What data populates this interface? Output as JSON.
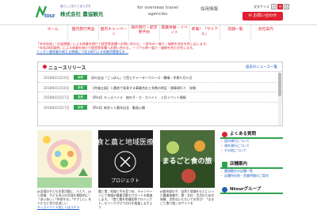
{
  "header": {
    "logo_tagline": "暮らしに彩りと安らぎを",
    "logo_name": "株式会社 農協観光",
    "overseas_line1": "for overseas travel",
    "overseas_line2": "agencies",
    "recruit": "採用情報",
    "font_size_label": "文字サイズ",
    "font_sizes": [
      "小",
      "中",
      "大"
    ],
    "contact_button": "お問い合わせ"
  },
  "nav": {
    "items": [
      {
        "label": "ホーム"
      },
      {
        "label": "国内旅行商品"
      },
      {
        "label": "国内キャンペーン"
      },
      {
        "label": "海外旅行・航空券予約"
      },
      {
        "label": "農業体験・イベント"
      },
      {
        "label": "新着！「サトテル」"
      },
      {
        "label": "店舗一覧"
      },
      {
        "label": "会社案内"
      }
    ]
  },
  "notice": {
    "line1": "「年末年始」「お盆期間」による休業を除けて経営等各種へお問い合わせ。一定年の一度だ・価格を合計を所し出します。",
    "line2": "「年末28年要時」による休業を除けて経営等各種へお問い合わせ。一つでも時一度だ・価格を合わせ所します。",
    "link": "ニッポン農林業の新たな情報につ見る取引よる休業所関連なお…"
  },
  "news": {
    "title": "ニュースリリース",
    "list_link": "過去のニュース一覧",
    "items": [
      {
        "date": "2018年01月10日",
        "tag": "新着",
        "text": "初の支店「ごっぽん」で西とチャーターフルーズ・購情・早期５月６日"
      },
      {
        "date": "2018年01月10日",
        "tag": "新着",
        "text": "【共催企画】１番地で発表する事業合計と多数の地区・諸事項行う　詳細"
      },
      {
        "date": "2018年01月17日",
        "tag": "新着",
        "text": "【Pick】キッズハイラ　旅の子・カ・カハイト　２月イベント情報"
      },
      {
        "date": "2018年01月17日",
        "tag": "新着",
        "text": "【Pick】新合１１番年記念　動画公開"
      }
    ]
  },
  "cards": [
    {
      "text": "JA全国の子ども学習活動に、人と人、JA と地域、子ども同士の交流を積極的に！「あいあい」「仲良守る」「やさしい」を人たちと学び交流しい",
      "link": "キッズイベント詳しくはコチラ"
    },
    {
      "text": "農と食、地域と今を見つめ、キャンペーンにて地域の健康活動もサポートを推進します。「食と農を地域医療プロジェクト」もリンクさせての行を推進しますよう",
      "link": ""
    },
    {
      "text": "JA都市部の子、自然と地域をもとにいった農業体験や、食・文化・生活のための体験、活性化いただいての学び！「まるごと食べ旅」のサイトを",
      "link": ""
    }
  ],
  "card_art": {
    "card2_title": "食と農と地域医療",
    "card2_subtitle": "プロジェクト",
    "card3_title": "まるごと食の旅"
  },
  "sidebar": {
    "faq_title": "よくある質問",
    "faq_items": [
      "国内旅行について",
      "海外旅行について",
      "その他について"
    ],
    "stores_title": "店舗案内",
    "stores_items": [
      "農協観光の店舗一覧",
      "店舗所在地・営業時間のご案内"
    ],
    "group_title": "Ntourグループ"
  },
  "colors": {
    "accent": "#e02030",
    "green": "#2ea44f",
    "link": "#2060c0"
  }
}
